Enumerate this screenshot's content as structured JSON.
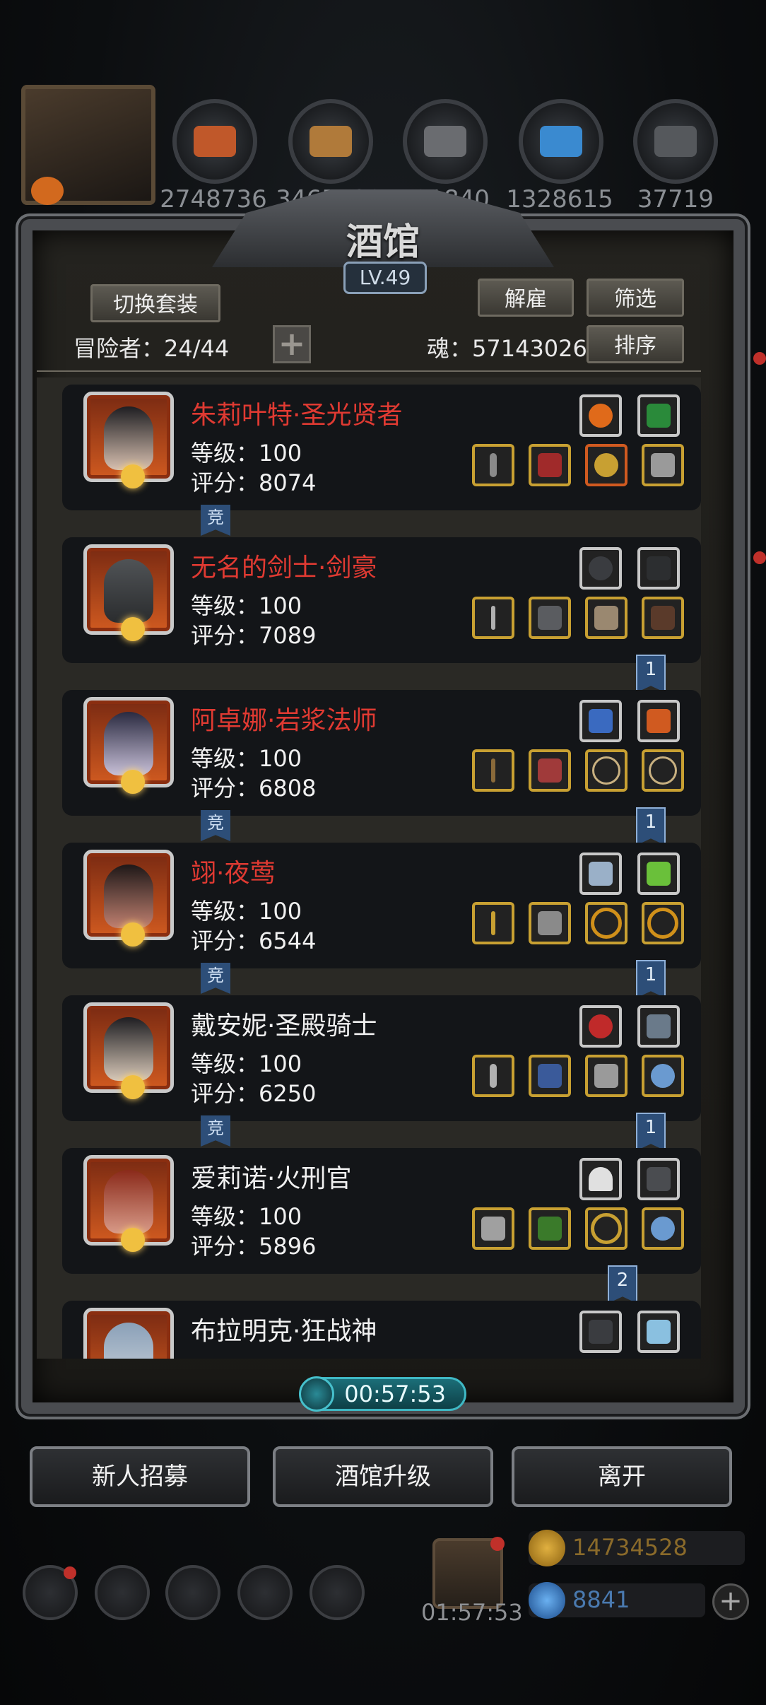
{
  "top_bar": {
    "resources": [
      {
        "icon": "meat-icon",
        "value": "2748736",
        "color": "#c0582a"
      },
      {
        "icon": "wood-icon",
        "value": "3465729",
        "color": "#b07a3a"
      },
      {
        "icon": "stone-icon",
        "value": "501840",
        "color": "#6a6c70"
      },
      {
        "icon": "crystal-icon",
        "value": "1328615",
        "color": "#3a8ad0"
      },
      {
        "icon": "iron-icon",
        "value": "37719",
        "color": "#55585c"
      }
    ]
  },
  "dialog": {
    "title": "酒馆",
    "level": "LV.49",
    "switch_outfit": "切换套装",
    "dismiss": "解雇",
    "filter": "筛选",
    "sort": "排序",
    "adventurers_label": "冒险者：24/44",
    "soul_label": "魂：57143026",
    "plus": "+"
  },
  "heroes": [
    {
      "name": "朱莉叶特·圣光贤者",
      "name_color": "red",
      "level": "等级：100",
      "score": "评分：8074",
      "comp": "竞",
      "num": ""
    },
    {
      "name": "无名的剑士·剑豪",
      "name_color": "red",
      "level": "等级：100",
      "score": "评分：7089",
      "comp": "",
      "num": "1"
    },
    {
      "name": "阿卓娜·岩浆法师",
      "name_color": "red",
      "level": "等级：100",
      "score": "评分：6808",
      "comp": "竞",
      "num": "1"
    },
    {
      "name": "翊·夜莺",
      "name_color": "red",
      "level": "等级：100",
      "score": "评分：6544",
      "comp": "竞",
      "num": "1"
    },
    {
      "name": "戴安妮·圣殿骑士",
      "name_color": "white",
      "level": "等级：100",
      "score": "评分：6250",
      "comp": "竞",
      "num": "1"
    },
    {
      "name": "爱莉诺·火刑官",
      "name_color": "white",
      "level": "等级：100",
      "score": "评分：5896",
      "comp": "",
      "num": "2"
    },
    {
      "name": "布拉明克·狂战神",
      "name_color": "white",
      "level": "",
      "score": "",
      "comp": "",
      "num": "2"
    }
  ],
  "timer": "00:57:53",
  "buttons": {
    "recruit": "新人招募",
    "upgrade": "酒馆升级",
    "leave": "离开"
  },
  "hud": {
    "gift_timer": "01:57:53",
    "gold": "14734528",
    "gems": "8841",
    "add": "+"
  }
}
